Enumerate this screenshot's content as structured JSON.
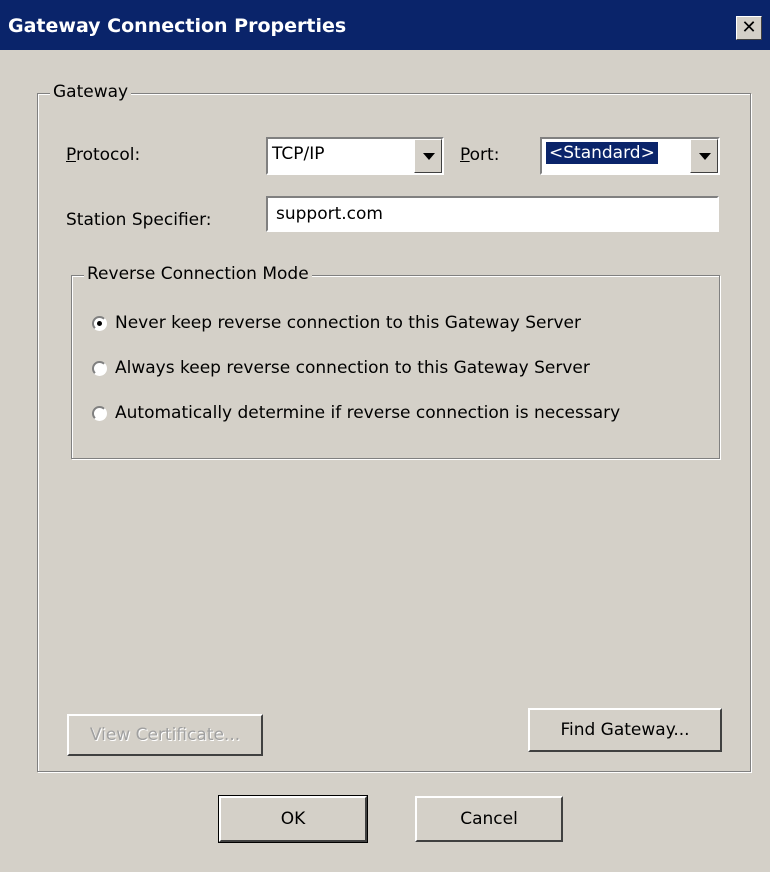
{
  "window": {
    "title": "Gateway Connection Properties",
    "close_glyph": "✕"
  },
  "gateway_group": {
    "legend": "Gateway",
    "protocol_label_ul": "P",
    "protocol_label_rest": "rotocol:",
    "protocol_value": "TCP/IP",
    "port_label_ul": "P",
    "port_label_rest": "ort:",
    "port_value": "<Standard>",
    "station_label": "Station Specifier:",
    "station_value": "support.com"
  },
  "reverse_group": {
    "legend": "Reverse Connection Mode",
    "options": [
      {
        "label": "Never keep reverse connection to this Gateway Server",
        "checked": true
      },
      {
        "label": "Always keep reverse connection to this Gateway Server",
        "checked": false
      },
      {
        "label": "Automatically determine if reverse connection is necessary",
        "checked": false
      }
    ]
  },
  "buttons": {
    "view_certificate": "View Certificate...",
    "find_gateway": "Find Gateway...",
    "ok": "OK",
    "cancel": "Cancel"
  },
  "colors": {
    "titlebar": "#0a246a",
    "face": "#d4d0c8",
    "selection": "#0a246a"
  }
}
